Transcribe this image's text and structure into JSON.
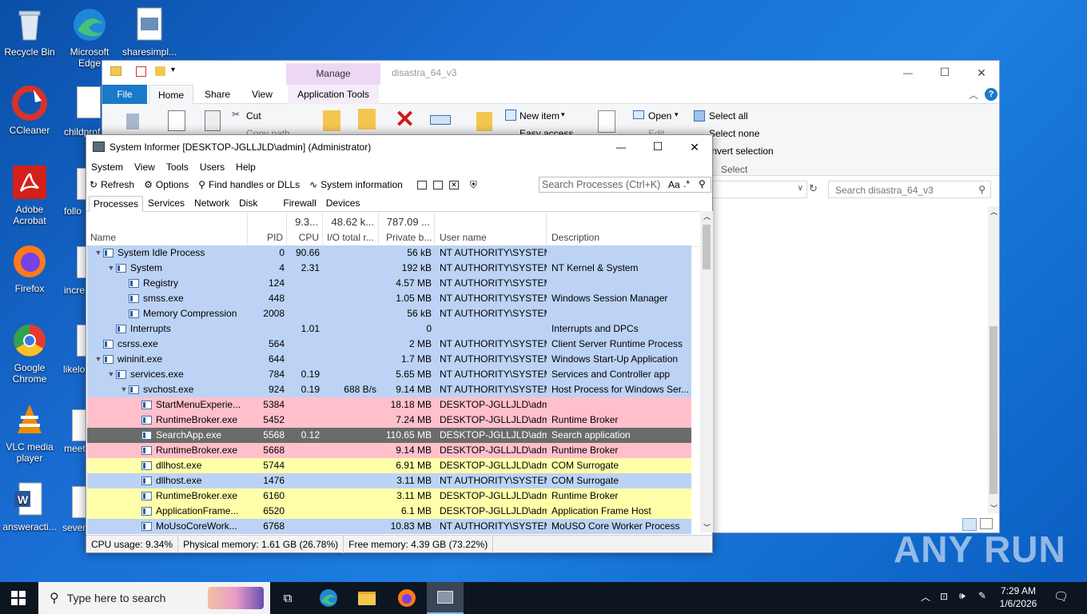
{
  "desktop": {
    "icons": [
      {
        "label": "Recycle Bin",
        "icon": "recycle-bin-icon"
      },
      {
        "label": "Microsoft Edge",
        "icon": "edge-icon"
      },
      {
        "label": "sharesimpl...",
        "icon": "image-file-icon"
      },
      {
        "label": "CCleaner",
        "icon": "ccleaner-icon"
      },
      {
        "label": "childprof",
        "icon": "image-file-icon"
      },
      {
        "label": "Adobe Acrobat",
        "icon": "acrobat-icon"
      },
      {
        "label": "follo",
        "icon": "image-file-icon"
      },
      {
        "label": "Firefox",
        "icon": "firefox-icon"
      },
      {
        "label": "incre",
        "icon": "image-file-icon"
      },
      {
        "label": "Google Chrome",
        "icon": "chrome-icon"
      },
      {
        "label": "likelo",
        "icon": "image-file-icon"
      },
      {
        "label": "VLC media player",
        "icon": "vlc-icon"
      },
      {
        "label": "meet",
        "icon": "word-doc-icon"
      },
      {
        "label": "answeracti...",
        "icon": "word-doc-icon"
      },
      {
        "label": "seven",
        "icon": "word-doc-icon"
      }
    ]
  },
  "explorer": {
    "manage_label": "Manage",
    "title": "disastra_64_v3",
    "tabs": {
      "file": "File",
      "home": "Home",
      "share": "Share",
      "view": "View",
      "app_tools": "Application Tools"
    },
    "ribbon": {
      "cut": "Cut",
      "copy_path": "Copy path",
      "new_item": "New item",
      "easy_access": "Easy access",
      "open": "Open",
      "edit": "Edit",
      "select_all": "Select all",
      "select_none": "Select none",
      "invert_selection": "Invert selection",
      "select_group": "Select"
    },
    "search_placeholder": "Search disastra_64_v3"
  },
  "sysinfo": {
    "title": "System Informer [DESKTOP-JGLLJLD\\admin] (Administrator)",
    "menu": [
      "System",
      "View",
      "Tools",
      "Users",
      "Help"
    ],
    "toolbar": {
      "refresh": "Refresh",
      "options": "Options",
      "find": "Find handles or DLLs",
      "sysinfo": "System information",
      "search_placeholder": "Search Processes (Ctrl+K)",
      "aa": "Aa"
    },
    "tabs": [
      "Processes",
      "Services",
      "Network",
      "Disk",
      "Firewall",
      "Devices"
    ],
    "columns": {
      "name": "Name",
      "pid": "PID",
      "cpu_total": "9.3...",
      "cpu": "CPU",
      "io_total": "48.62 k...",
      "io": "I/O total r...",
      "priv_total": "787.09 ...",
      "priv": "Private b...",
      "user": "User name",
      "desc": "Description"
    },
    "rows": [
      {
        "indent": 0,
        "exp": "open",
        "name": "System Idle Process",
        "pid": "0",
        "cpu": "90.66",
        "io": "",
        "priv": "56 kB",
        "user": "NT AUTHORITY\\SYSTEM",
        "desc": "",
        "color": "#bcd3f5",
        "text": "#000"
      },
      {
        "indent": 1,
        "exp": "open",
        "name": "System",
        "pid": "4",
        "cpu": "2.31",
        "io": "",
        "priv": "192 kB",
        "user": "NT AUTHORITY\\SYSTEM",
        "desc": "NT Kernel & System",
        "color": "#bcd3f5",
        "text": "#000"
      },
      {
        "indent": 2,
        "exp": "",
        "name": "Registry",
        "pid": "124",
        "cpu": "",
        "io": "",
        "priv": "4.57 MB",
        "user": "NT AUTHORITY\\SYSTEM",
        "desc": "",
        "color": "#bcd3f5",
        "text": "#000"
      },
      {
        "indent": 2,
        "exp": "",
        "name": "smss.exe",
        "pid": "448",
        "cpu": "",
        "io": "",
        "priv": "1.05 MB",
        "user": "NT AUTHORITY\\SYSTEM",
        "desc": "Windows Session Manager",
        "color": "#bcd3f5",
        "text": "#000"
      },
      {
        "indent": 2,
        "exp": "",
        "name": "Memory Compression",
        "pid": "2008",
        "cpu": "",
        "io": "",
        "priv": "56 kB",
        "user": "NT AUTHORITY\\SYSTEM",
        "desc": "",
        "color": "#bcd3f5",
        "text": "#000"
      },
      {
        "indent": 1,
        "exp": "",
        "name": "Interrupts",
        "pid": "",
        "cpu": "1.01",
        "io": "",
        "priv": "0",
        "user": "",
        "desc": "Interrupts and DPCs",
        "color": "#bcd3f5",
        "text": "#000"
      },
      {
        "indent": 0,
        "exp": "",
        "name": "csrss.exe",
        "pid": "564",
        "cpu": "",
        "io": "",
        "priv": "2 MB",
        "user": "NT AUTHORITY\\SYSTEM",
        "desc": "Client Server Runtime Process",
        "color": "#bcd3f5",
        "text": "#000"
      },
      {
        "indent": 0,
        "exp": "open",
        "name": "wininit.exe",
        "pid": "644",
        "cpu": "",
        "io": "",
        "priv": "1.7 MB",
        "user": "NT AUTHORITY\\SYSTEM",
        "desc": "Windows Start-Up Application",
        "color": "#bcd3f5",
        "text": "#000"
      },
      {
        "indent": 1,
        "exp": "open",
        "name": "services.exe",
        "pid": "784",
        "cpu": "0.19",
        "io": "",
        "priv": "5.65 MB",
        "user": "NT AUTHORITY\\SYSTEM",
        "desc": "Services and Controller app",
        "color": "#bcd3f5",
        "text": "#000"
      },
      {
        "indent": 2,
        "exp": "open",
        "name": "svchost.exe",
        "pid": "924",
        "cpu": "0.19",
        "io": "688 B/s",
        "priv": "9.14 MB",
        "user": "NT AUTHORITY\\SYSTEM",
        "desc": "Host Process for Windows Ser...",
        "color": "#bcd3f5",
        "text": "#000"
      },
      {
        "indent": 3,
        "exp": "",
        "name": "StartMenuExperie...",
        "pid": "5384",
        "cpu": "",
        "io": "",
        "priv": "18.18 MB",
        "user": "DESKTOP-JGLLJLD\\admi",
        "desc": "",
        "color": "#ffc0cb",
        "text": "#000"
      },
      {
        "indent": 3,
        "exp": "",
        "name": "RuntimeBroker.exe",
        "pid": "5452",
        "cpu": "",
        "io": "",
        "priv": "7.24 MB",
        "user": "DESKTOP-JGLLJLD\\admi",
        "desc": "Runtime Broker",
        "color": "#ffc0cb",
        "text": "#000"
      },
      {
        "indent": 3,
        "exp": "",
        "name": "SearchApp.exe",
        "pid": "5568",
        "cpu": "0.12",
        "io": "",
        "priv": "110.65 MB",
        "user": "DESKTOP-JGLLJLD\\admi",
        "desc": "Search application",
        "color": "#6b6b6b",
        "text": "#fff"
      },
      {
        "indent": 3,
        "exp": "",
        "name": "RuntimeBroker.exe",
        "pid": "5668",
        "cpu": "",
        "io": "",
        "priv": "9.14 MB",
        "user": "DESKTOP-JGLLJLD\\admi",
        "desc": "Runtime Broker",
        "color": "#ffc0cb",
        "text": "#000"
      },
      {
        "indent": 3,
        "exp": "",
        "name": "dllhost.exe",
        "pid": "5744",
        "cpu": "",
        "io": "",
        "priv": "6.91 MB",
        "user": "DESKTOP-JGLLJLD\\admi",
        "desc": "COM Surrogate",
        "color": "#ffffaa",
        "text": "#000"
      },
      {
        "indent": 3,
        "exp": "",
        "name": "dllhost.exe",
        "pid": "1476",
        "cpu": "",
        "io": "",
        "priv": "3.11 MB",
        "user": "NT AUTHORITY\\SYSTEM",
        "desc": "COM Surrogate",
        "color": "#bcd3f5",
        "text": "#000"
      },
      {
        "indent": 3,
        "exp": "",
        "name": "RuntimeBroker.exe",
        "pid": "6160",
        "cpu": "",
        "io": "",
        "priv": "3.11 MB",
        "user": "DESKTOP-JGLLJLD\\admi",
        "desc": "Runtime Broker",
        "color": "#ffffaa",
        "text": "#000"
      },
      {
        "indent": 3,
        "exp": "",
        "name": "ApplicationFrame...",
        "pid": "6520",
        "cpu": "",
        "io": "",
        "priv": "6.1 MB",
        "user": "DESKTOP-JGLLJLD\\admi",
        "desc": "Application Frame Host",
        "color": "#ffffaa",
        "text": "#000"
      },
      {
        "indent": 3,
        "exp": "",
        "name": "MoUsoCoreWork...",
        "pid": "6768",
        "cpu": "",
        "io": "",
        "priv": "10.83 MB",
        "user": "NT AUTHORITY\\SYSTEM",
        "desc": "MoUSO Core Worker Process",
        "color": "#bcd3f5",
        "text": "#000"
      }
    ],
    "status": {
      "cpu": "CPU usage: 9.34%",
      "phys": "Physical memory: 1.61 GB (26.78%)",
      "free": "Free memory: 4.39 GB (73.22%)"
    }
  },
  "taskbar": {
    "search_placeholder": "Type here to search",
    "time": "7:29 AM",
    "date": "1/6/2026"
  },
  "watermark": "ANY RUN"
}
